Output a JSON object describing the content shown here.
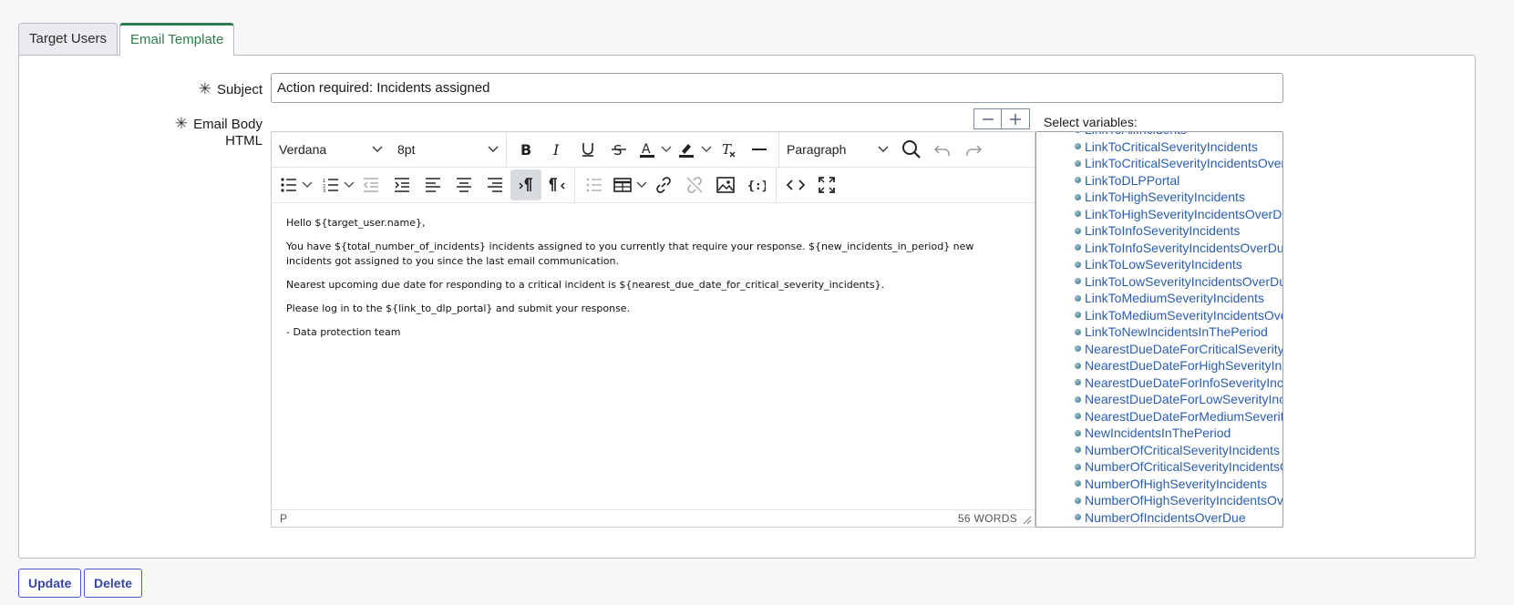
{
  "tabs": [
    {
      "label": "Target Users",
      "active": false
    },
    {
      "label": "Email Template",
      "active": true
    }
  ],
  "form": {
    "subject_label": "Subject",
    "subject_value": "Action required: Incidents assigned",
    "body_label": "Email Body HTML",
    "required_marker": "✳"
  },
  "editor": {
    "font_family": "Verdana",
    "font_size": "8pt",
    "block_format": "Paragraph",
    "paragraphs": [
      "Hello ${target_user.name},",
      "You have ${total_number_of_incidents} incidents assigned to you currently that require your response. ${new_incidents_in_period} new incidents got assigned to you since the last email communication.",
      "Nearest upcoming due date for responding to a critical incident is ${nearest_due_date_for_critical_severity_incidents}.",
      "Please log in to the ${link_to_dlp_portal} and submit your response.",
      "- Data protection team"
    ],
    "status_path": "P",
    "word_count": "56 WORDS",
    "toolbar_row1_icons": [
      "bold-icon",
      "italic-icon",
      "underline-icon",
      "strikethrough-icon",
      "text-color-icon",
      "highlight-icon",
      "clear-format-icon",
      "horizontal-rule-icon",
      "search-icon",
      "undo-icon",
      "redo-icon"
    ],
    "toolbar_row2_icons": [
      "bullet-list-icon",
      "numbered-list-icon",
      "outdent-icon",
      "indent-icon",
      "align-left-icon",
      "align-center-icon",
      "align-right-icon",
      "ltr-icon",
      "rtl-icon",
      "list-icon",
      "table-icon",
      "link-icon",
      "unlink-icon",
      "image-icon",
      "template-variable-icon",
      "code-icon",
      "fullscreen-icon"
    ]
  },
  "variables": {
    "label": "Select variables:",
    "items": [
      "LinkToAllIncidents",
      "LinkToCriticalSeverityIncidents",
      "LinkToCriticalSeverityIncidentsOverDue",
      "LinkToDLPPortal",
      "LinkToHighSeverityIncidents",
      "LinkToHighSeverityIncidentsOverDue",
      "LinkToInfoSeverityIncidents",
      "LinkToInfoSeverityIncidentsOverDue",
      "LinkToLowSeverityIncidents",
      "LinkToLowSeverityIncidentsOverDue",
      "LinkToMediumSeverityIncidents",
      "LinkToMediumSeverityIncidentsOverDue",
      "LinkToNewIncidentsInThePeriod",
      "NearestDueDateForCriticalSeverityIncidents",
      "NearestDueDateForHighSeverityIncidents",
      "NearestDueDateForInfoSeverityIncidents",
      "NearestDueDateForLowSeverityIncidents",
      "NearestDueDateForMediumSeverityIncidents",
      "NewIncidentsInThePeriod",
      "NumberOfCriticalSeverityIncidents",
      "NumberOfCriticalSeverityIncidentsOverDue",
      "NumberOfHighSeverityIncidents",
      "NumberOfHighSeverityIncidentsOverDue",
      "NumberOfIncidentsOverDue"
    ]
  },
  "actions": {
    "update_label": "Update",
    "delete_label": "Delete"
  },
  "colors": {
    "accent_green": "#2e7d4f",
    "link_blue": "#2a5db0",
    "button_blue": "#3346a8"
  }
}
